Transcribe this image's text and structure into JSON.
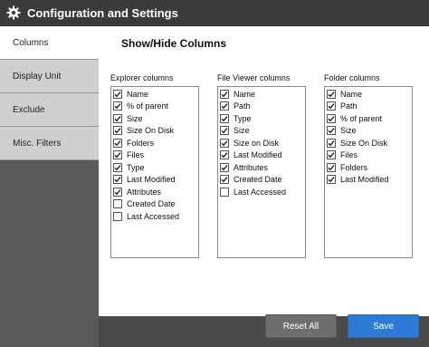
{
  "window": {
    "title": "Configuration and Settings"
  },
  "sidebar": {
    "items": [
      {
        "label": "Columns",
        "active": true
      },
      {
        "label": "Display Unit",
        "active": false
      },
      {
        "label": "Exclude",
        "active": false
      },
      {
        "label": "Misc. Filters",
        "active": false
      }
    ]
  },
  "panel": {
    "title": "Show/Hide Columns",
    "columns": [
      {
        "label": "Explorer columns",
        "items": [
          {
            "label": "Name",
            "checked": true
          },
          {
            "label": "% of parent",
            "checked": true
          },
          {
            "label": "Size",
            "checked": true
          },
          {
            "label": "Size On Disk",
            "checked": true
          },
          {
            "label": "Folders",
            "checked": true
          },
          {
            "label": "Files",
            "checked": true
          },
          {
            "label": "Type",
            "checked": true
          },
          {
            "label": "Last Modified",
            "checked": true
          },
          {
            "label": "Attributes",
            "checked": true
          },
          {
            "label": "Created Date",
            "checked": false
          },
          {
            "label": "Last Accessed",
            "checked": false
          }
        ]
      },
      {
        "label": "File Viewer columns",
        "items": [
          {
            "label": "Name",
            "checked": true
          },
          {
            "label": "Path",
            "checked": true
          },
          {
            "label": "Type",
            "checked": true
          },
          {
            "label": "Size",
            "checked": true
          },
          {
            "label": "Size on Disk",
            "checked": true
          },
          {
            "label": "Last Modified",
            "checked": true
          },
          {
            "label": "Attributes",
            "checked": true
          },
          {
            "label": "Created Date",
            "checked": true
          },
          {
            "label": "Last Accessed",
            "checked": false
          }
        ]
      },
      {
        "label": "Folder columns",
        "items": [
          {
            "label": "Name",
            "checked": true
          },
          {
            "label": "Path",
            "checked": true
          },
          {
            "label": "% of parent",
            "checked": true
          },
          {
            "label": "Size",
            "checked": true
          },
          {
            "label": "Size On Disk",
            "checked": true
          },
          {
            "label": "Files",
            "checked": true
          },
          {
            "label": "Folders",
            "checked": true
          },
          {
            "label": "Last Modified",
            "checked": true
          }
        ]
      }
    ]
  },
  "buttons": {
    "reset_label": "Reset All",
    "save_label": "Save"
  },
  "colors": {
    "accent": "#2e7bd6",
    "titlebar": "#3b3b3b",
    "sidebar_bg": "#5a5a5a"
  },
  "icons": {
    "title": "gear-icon",
    "check": "checkmark-icon"
  }
}
